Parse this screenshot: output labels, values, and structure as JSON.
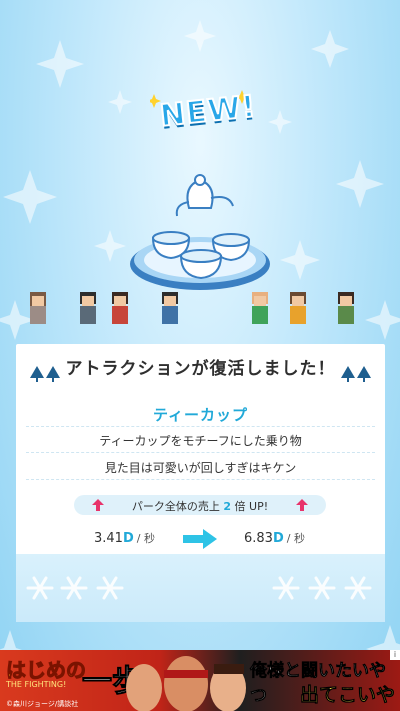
{
  "badge": {
    "text": "NEW!"
  },
  "result_panel": {
    "title": "アトラクションが復活しました！",
    "attraction_name": "ティーカップ",
    "description_lines": [
      "ティーカップをモチーフにした乗り物",
      "見た目は可愛いが回しすぎはキケン"
    ],
    "boost": {
      "prefix": "パーク全体の売上",
      "multiplier": "2",
      "suffix": "倍 UP!"
    },
    "rate_before": {
      "value": "3.41",
      "unit": "D",
      "per": "/ 秒"
    },
    "rate_after": {
      "value": "6.83",
      "unit": "D",
      "per": "/ 秒"
    }
  },
  "ad": {
    "logo": "はじめの",
    "logo_kanji": "一歩",
    "subtitle": "THE FIGHTING!",
    "copyright": "©森川ジョージ/講談社",
    "headline1": "俺様と闘いたいやつ",
    "headline2": "出てこいや",
    "info_icon": "info-icon"
  },
  "colors": {
    "accent": "#21a9d8",
    "arrow_pink": "#e8336b",
    "arrow_cyan": "#2ec3e6"
  }
}
